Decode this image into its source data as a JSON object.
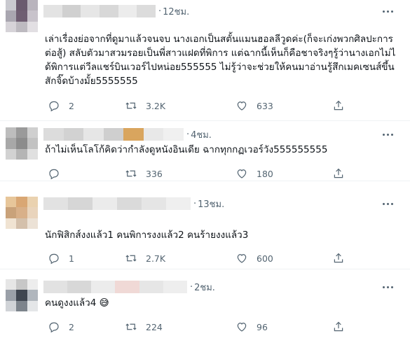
{
  "tweets": [
    {
      "time": "12ชม.",
      "text": "เล่าเรื่องย่อจากที่ดูมาแล้วจนจบ นางเอกเป็นสตั้นแมนฮอลลีวูดค่ะ(ก็จะเก่งพวกศิลปะการต่อสู้) สลับตัวมาสวมรอยเป็นพี่สาวแฝดที่พิการ แต่ฉากนี้เห็นก็คือชาจริงๆรู้ว่านางเอกไม่ได้พิการแต่วีลแชร์บินเวอร์ไปหน่อย555555 ไม่รู้ว่าจะช่วยให้คนมาอ่านรู้สึกเมคเซนส์ขึ้นสักจิ๊ดบ้างมั้ย5555555",
      "replies": "2",
      "retweets": "3.2K",
      "likes": "633",
      "avatar_colors": [
        "#c9c9cf",
        "#6a5a6e",
        "#b9b4bd",
        "#a9a6b0",
        "#6f5e72",
        "#c8c3cb",
        "#d6d3d8",
        "#bdbac0",
        "#e2dfe3"
      ],
      "name_colors": [
        "#e3e3e3",
        "#d0d0d0",
        "#e6e6e6",
        "#d8d8d8",
        "#ececec",
        "#dcdcdc"
      ]
    },
    {
      "time": "4ชม.",
      "text": "ถ้าไม่เห็นโลโก้คิดว่ากำลังดูหนังอินเดีย ฉากทุกกฏเวอร์วัง555555555",
      "replies": "",
      "retweets": "336",
      "likes": "180",
      "avatar_colors": [
        "#bdbdbd",
        "#9a9a9a",
        "#cfcfcf",
        "#a8a8a8",
        "#8c8c8c",
        "#c2c2c2",
        "#d2d2d2",
        "#b5b5b5",
        "#e0e0e0"
      ],
      "name_colors": [
        "#dcdcdc",
        "#d2d2d2",
        "#e6e6e6",
        "#cfcfcf",
        "#d9a55e",
        "#e8e8e8",
        "#f0f0f0"
      ]
    },
    {
      "time": "13ชม.",
      "text": "นักฟิสิกส์งงแล้ว1 คนพิการงงแล้ว2 คนร้ายงงแล้ว3",
      "replies": "1",
      "retweets": "2.7K",
      "likes": "600",
      "avatar_colors": [
        "#e7c69a",
        "#d9a774",
        "#ead2b0",
        "#c9a27a",
        "#d8b089",
        "#e9d4bc",
        "#f0e3d2",
        "#d4c0ab",
        "#ece2d6"
      ],
      "name_colors": [
        "#e2e2e2",
        "#d6d6d6",
        "#ebebeb",
        "#dadada",
        "#e5e5e5",
        "#efefef"
      ]
    },
    {
      "time": "2ชม.",
      "text": "คนดูงงแล้ว4 😅",
      "replies": "2",
      "retweets": "224",
      "likes": "96",
      "avatar_colors": [
        "#e6e6e6",
        "#c7c7c7",
        "#ededed",
        "#9aa0a8",
        "#3f4650",
        "#b0b6bd",
        "#d0d3d7",
        "#7d848c",
        "#e4e6e8"
      ],
      "name_colors": [
        "#e2e2e2",
        "#d8d8d8",
        "#ececec",
        "#f0d9d6",
        "#e6e6e6",
        "#eeeeee"
      ]
    }
  ]
}
